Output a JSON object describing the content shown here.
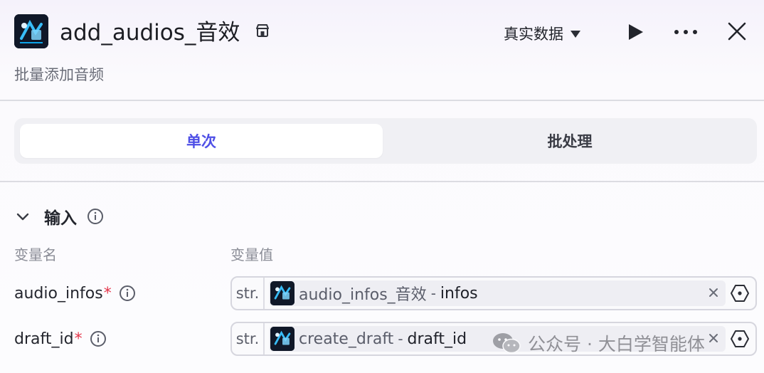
{
  "header": {
    "title": "add_audios_音效",
    "subtitle": "批量添加音频",
    "data_mode": "真实数据"
  },
  "tabs": [
    {
      "label": "单次",
      "active": true
    },
    {
      "label": "批处理",
      "active": false
    }
  ],
  "inputs": {
    "section_title": "输入",
    "col_name": "变量名",
    "col_value": "变量值",
    "rows": [
      {
        "name": "audio_infos",
        "required_mark": "*",
        "type": "str.",
        "ref_node": "audio_infos_音效",
        "separator": "-",
        "ref_field": "infos"
      },
      {
        "name": "draft_id",
        "required_mark": "*",
        "type": "str.",
        "ref_node": "create_draft",
        "separator": "-",
        "ref_field": "draft_id"
      }
    ]
  },
  "watermark": {
    "text": "公众号 · 大白学智能体",
    "icon": "wechat-icon"
  },
  "colors": {
    "accent": "#4e4fe6",
    "required": "#e5364b",
    "icon_bg": "#101828"
  }
}
